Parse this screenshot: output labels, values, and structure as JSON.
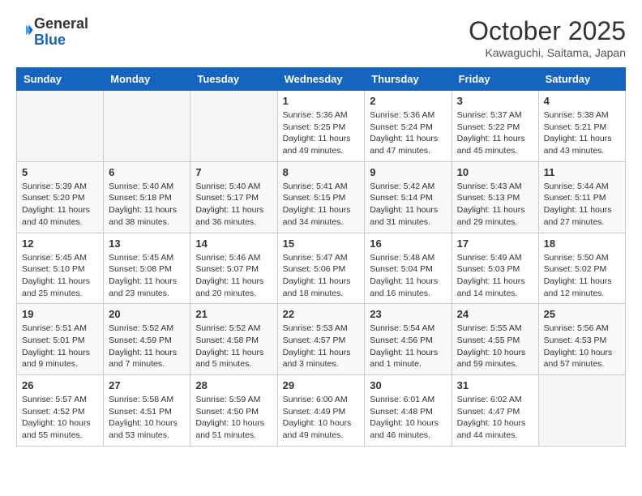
{
  "header": {
    "logo_general": "General",
    "logo_blue": "Blue",
    "month_title": "October 2025",
    "location": "Kawaguchi, Saitama, Japan"
  },
  "weekdays": [
    "Sunday",
    "Monday",
    "Tuesday",
    "Wednesday",
    "Thursday",
    "Friday",
    "Saturday"
  ],
  "weeks": [
    [
      null,
      null,
      null,
      {
        "day": 1,
        "sunrise": "5:36 AM",
        "sunset": "5:25 PM",
        "daylight": "11 hours and 49 minutes."
      },
      {
        "day": 2,
        "sunrise": "5:36 AM",
        "sunset": "5:24 PM",
        "daylight": "11 hours and 47 minutes."
      },
      {
        "day": 3,
        "sunrise": "5:37 AM",
        "sunset": "5:22 PM",
        "daylight": "11 hours and 45 minutes."
      },
      {
        "day": 4,
        "sunrise": "5:38 AM",
        "sunset": "5:21 PM",
        "daylight": "11 hours and 43 minutes."
      }
    ],
    [
      {
        "day": 5,
        "sunrise": "5:39 AM",
        "sunset": "5:20 PM",
        "daylight": "11 hours and 40 minutes."
      },
      {
        "day": 6,
        "sunrise": "5:40 AM",
        "sunset": "5:18 PM",
        "daylight": "11 hours and 38 minutes."
      },
      {
        "day": 7,
        "sunrise": "5:40 AM",
        "sunset": "5:17 PM",
        "daylight": "11 hours and 36 minutes."
      },
      {
        "day": 8,
        "sunrise": "5:41 AM",
        "sunset": "5:15 PM",
        "daylight": "11 hours and 34 minutes."
      },
      {
        "day": 9,
        "sunrise": "5:42 AM",
        "sunset": "5:14 PM",
        "daylight": "11 hours and 31 minutes."
      },
      {
        "day": 10,
        "sunrise": "5:43 AM",
        "sunset": "5:13 PM",
        "daylight": "11 hours and 29 minutes."
      },
      {
        "day": 11,
        "sunrise": "5:44 AM",
        "sunset": "5:11 PM",
        "daylight": "11 hours and 27 minutes."
      }
    ],
    [
      {
        "day": 12,
        "sunrise": "5:45 AM",
        "sunset": "5:10 PM",
        "daylight": "11 hours and 25 minutes."
      },
      {
        "day": 13,
        "sunrise": "5:45 AM",
        "sunset": "5:08 PM",
        "daylight": "11 hours and 23 minutes."
      },
      {
        "day": 14,
        "sunrise": "5:46 AM",
        "sunset": "5:07 PM",
        "daylight": "11 hours and 20 minutes."
      },
      {
        "day": 15,
        "sunrise": "5:47 AM",
        "sunset": "5:06 PM",
        "daylight": "11 hours and 18 minutes."
      },
      {
        "day": 16,
        "sunrise": "5:48 AM",
        "sunset": "5:04 PM",
        "daylight": "11 hours and 16 minutes."
      },
      {
        "day": 17,
        "sunrise": "5:49 AM",
        "sunset": "5:03 PM",
        "daylight": "11 hours and 14 minutes."
      },
      {
        "day": 18,
        "sunrise": "5:50 AM",
        "sunset": "5:02 PM",
        "daylight": "11 hours and 12 minutes."
      }
    ],
    [
      {
        "day": 19,
        "sunrise": "5:51 AM",
        "sunset": "5:01 PM",
        "daylight": "11 hours and 9 minutes."
      },
      {
        "day": 20,
        "sunrise": "5:52 AM",
        "sunset": "4:59 PM",
        "daylight": "11 hours and 7 minutes."
      },
      {
        "day": 21,
        "sunrise": "5:52 AM",
        "sunset": "4:58 PM",
        "daylight": "11 hours and 5 minutes."
      },
      {
        "day": 22,
        "sunrise": "5:53 AM",
        "sunset": "4:57 PM",
        "daylight": "11 hours and 3 minutes."
      },
      {
        "day": 23,
        "sunrise": "5:54 AM",
        "sunset": "4:56 PM",
        "daylight": "11 hours and 1 minute."
      },
      {
        "day": 24,
        "sunrise": "5:55 AM",
        "sunset": "4:55 PM",
        "daylight": "10 hours and 59 minutes."
      },
      {
        "day": 25,
        "sunrise": "5:56 AM",
        "sunset": "4:53 PM",
        "daylight": "10 hours and 57 minutes."
      }
    ],
    [
      {
        "day": 26,
        "sunrise": "5:57 AM",
        "sunset": "4:52 PM",
        "daylight": "10 hours and 55 minutes."
      },
      {
        "day": 27,
        "sunrise": "5:58 AM",
        "sunset": "4:51 PM",
        "daylight": "10 hours and 53 minutes."
      },
      {
        "day": 28,
        "sunrise": "5:59 AM",
        "sunset": "4:50 PM",
        "daylight": "10 hours and 51 minutes."
      },
      {
        "day": 29,
        "sunrise": "6:00 AM",
        "sunset": "4:49 PM",
        "daylight": "10 hours and 49 minutes."
      },
      {
        "day": 30,
        "sunrise": "6:01 AM",
        "sunset": "4:48 PM",
        "daylight": "10 hours and 46 minutes."
      },
      {
        "day": 31,
        "sunrise": "6:02 AM",
        "sunset": "4:47 PM",
        "daylight": "10 hours and 44 minutes."
      },
      null
    ]
  ]
}
